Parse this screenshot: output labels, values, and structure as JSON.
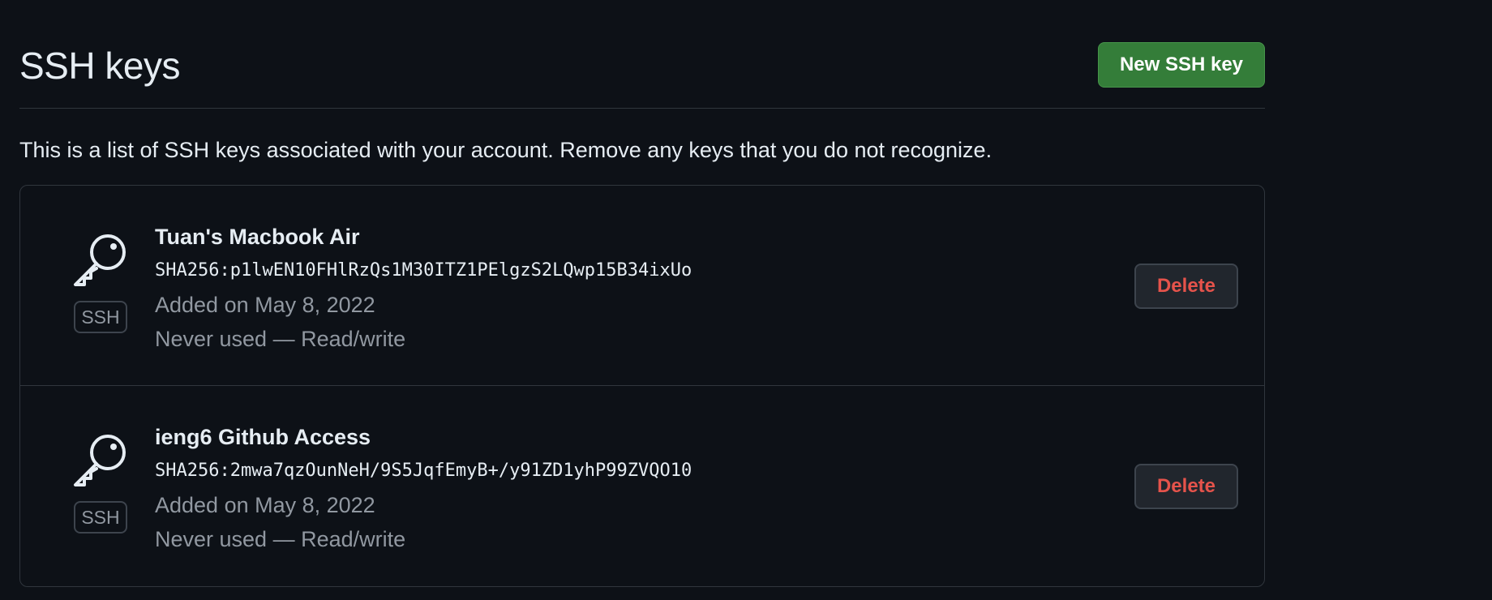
{
  "header": {
    "title": "SSH keys",
    "new_key_label": "New SSH key"
  },
  "description": "This is a list of SSH keys associated with your account. Remove any keys that you do not recognize.",
  "keys": [
    {
      "title": "Tuan's Macbook Air",
      "fingerprint": "SHA256:p1lwEN10FHlRzQs1M30ITZ1PElgzS2LQwp15B34ixUo",
      "added": "Added on May 8, 2022",
      "usage": "Never used — Read/write",
      "badge": "SSH",
      "icon": "key-icon",
      "delete_label": "Delete"
    },
    {
      "title": "ieng6 Github Access",
      "fingerprint": "SHA256:2mwa7qzOunNeH/9S5JqfEmyB+/y91ZD1yhP99ZVQO10",
      "added": "Added on May 8, 2022",
      "usage": "Never used — Read/write",
      "badge": "SSH",
      "icon": "key-icon",
      "delete_label": "Delete"
    }
  ],
  "colors": {
    "background": "#0d1117",
    "primary_button": "#347d39",
    "danger_text": "#e5534b",
    "muted_text": "#9198a1",
    "border": "#30363d"
  }
}
